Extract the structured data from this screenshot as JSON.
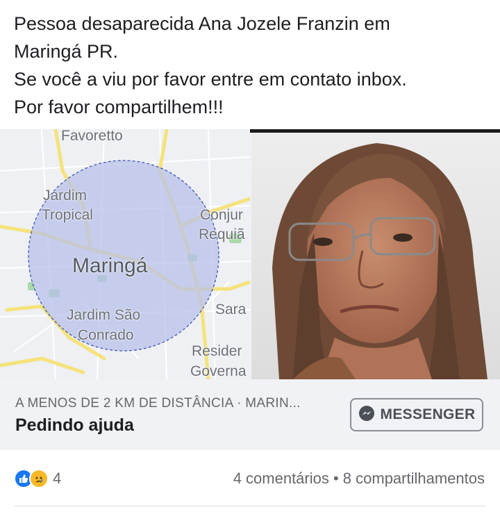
{
  "post": {
    "text_lines": [
      "Pessoa desaparecida Ana Jozele Franzin em",
      "Maringá PR.",
      "Se você a viu  por favor entre em contato inbox.",
      "Por favor compartilhem!!!"
    ]
  },
  "map": {
    "labels": {
      "favoretto": "Favoretto",
      "jardim": "Jardim",
      "tropical": "Tropical",
      "city": "Maringá",
      "conjur": "Conjur",
      "requia": "Requiã",
      "sara": "Sara",
      "jardim_sao": "Jardim São",
      "conrado": "Conrado",
      "resider": "Resider",
      "governa": "Governa"
    },
    "radius_fill": "#b8c2ea",
    "road_color": "#f5e27a"
  },
  "cta": {
    "distance": "A MENOS DE 2 KM DE DISTÂNCIA · MARIN...",
    "title": "Pedindo ajuda",
    "messenger_label": "MESSENGER",
    "messenger_icon": "messenger-icon"
  },
  "footer": {
    "reaction_icons": [
      "like-icon",
      "sad-icon"
    ],
    "reaction_count": "4",
    "engagement": "4 comentários • 8 compartilhamentos"
  },
  "colors": {
    "like_blue": "#1877f2",
    "sad_yellow": "#f7b928",
    "text_secondary": "#65676b"
  }
}
